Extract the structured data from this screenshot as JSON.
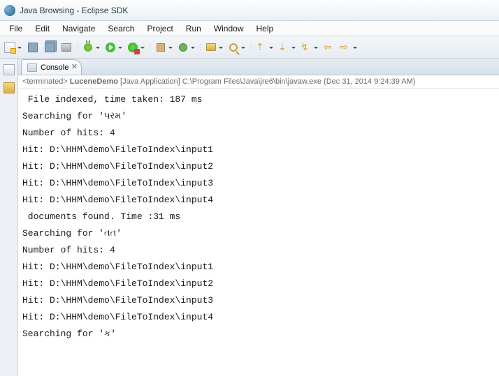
{
  "window": {
    "title": "Java Browsing - Eclipse SDK"
  },
  "menu": {
    "items": [
      "File",
      "Edit",
      "Navigate",
      "Search",
      "Project",
      "Run",
      "Window",
      "Help"
    ]
  },
  "tab": {
    "label": "Console",
    "close_glyph": "✕"
  },
  "status": {
    "terminated_prefix": "<terminated> ",
    "app_name": "LuceneDemo",
    "app_type": " [Java Application] ",
    "path": "C:\\Program Files\\Java\\jre6\\bin\\javaw.exe",
    "timestamp": " (Dec 31, 2014 9:24:39 AM)"
  },
  "console": {
    "lines": [
      " File indexed, time taken: 187 ms",
      "Searching for 'પરમ'",
      "Number of hits: 4",
      "Hit: D:\\HHM\\demo\\FileToIndex\\input1",
      "Hit: D:\\HHM\\demo\\FileToIndex\\input2",
      "Hit: D:\\HHM\\demo\\FileToIndex\\input3",
      "Hit: D:\\HHM\\demo\\FileToIndex\\input4",
      " documents found. Time :31 ms",
      "Searching for 'તત'",
      "Number of hits: 4",
      "Hit: D:\\HHM\\demo\\FileToIndex\\input1",
      "Hit: D:\\HHM\\demo\\FileToIndex\\input2",
      "Hit: D:\\HHM\\demo\\FileToIndex\\input3",
      "Hit: D:\\HHM\\demo\\FileToIndex\\input4",
      "Searching for 'ક'"
    ]
  }
}
